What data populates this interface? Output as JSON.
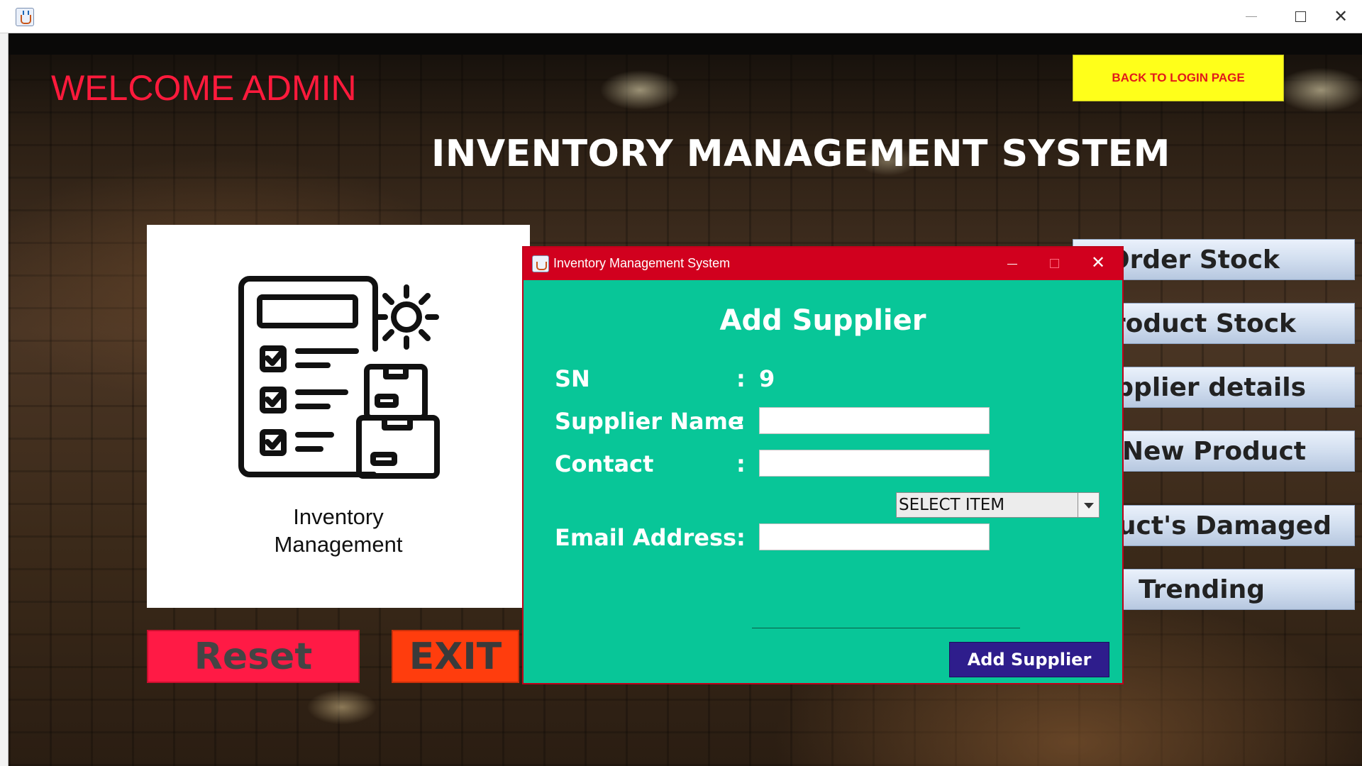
{
  "window": {
    "icon": "java-app-icon",
    "minimize": "minimize-icon",
    "maximize": "maximize-icon",
    "close": "close-icon"
  },
  "header": {
    "welcome": "WELCOME ADMIN",
    "back_button": "BACK TO LOGIN PAGE",
    "title": "INVENTORY MANAGEMENT SYSTEM"
  },
  "logo": {
    "icon": "inventory-checklist-icon",
    "caption_line1": "Inventory",
    "caption_line2": "Management"
  },
  "buttons": {
    "reset": "Reset",
    "exit": "EXIT"
  },
  "nav": [
    {
      "label": "Order Stock"
    },
    {
      "label": "Product Stock"
    },
    {
      "label": "Supplier details"
    },
    {
      "label": "Add New Product"
    },
    {
      "label": "Product's Damaged"
    },
    {
      "label": "Trending"
    }
  ],
  "dialog": {
    "title": "Inventory Management System",
    "heading": "Add Supplier",
    "sn_label": "SN",
    "sn_value": "9",
    "colon": ":",
    "supplier_name_label": "Supplier Name",
    "supplier_name_value": "",
    "contact_label": "Contact",
    "contact_value": "",
    "item_select": "SELECT ITEM",
    "email_label": "Email Address",
    "email_value": "",
    "submit": "Add Supplier"
  },
  "colors": {
    "welcome": "#ff1a3c",
    "back_button_bg": "#ffff1a",
    "dialog_bg": "#08c698",
    "dialog_titlebar": "#d1001e",
    "submit_bg": "#2e1d8c",
    "reset_bg": "#ff1a45",
    "exit_bg": "#ff3d0d"
  }
}
